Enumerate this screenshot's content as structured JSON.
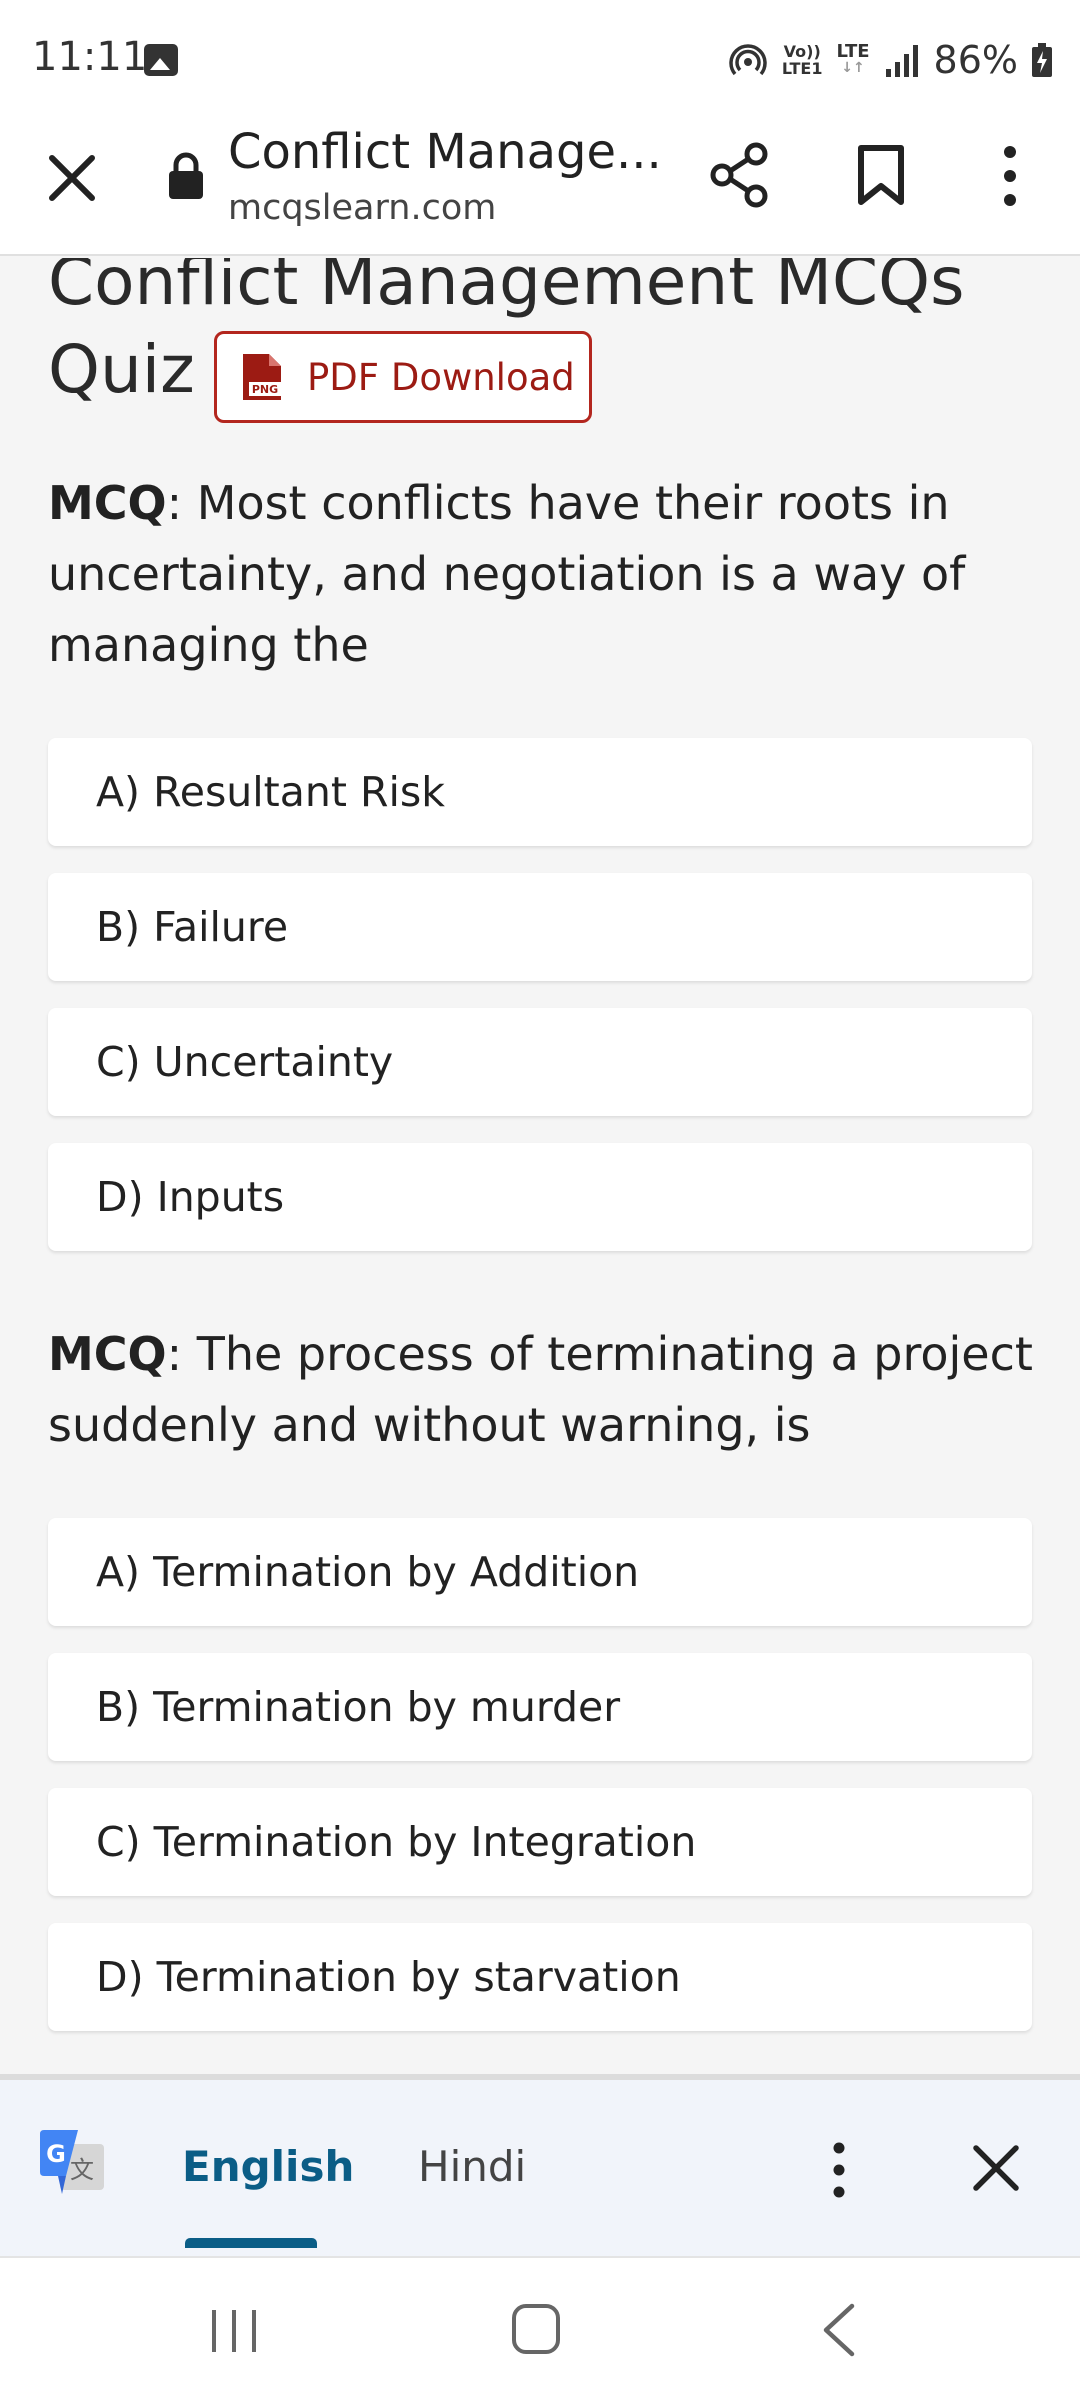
{
  "status_bar": {
    "time": "11:11",
    "volte_top": "Vo))",
    "volte_bottom": "LTE1",
    "network": "LTE",
    "battery": "86%"
  },
  "toolbar": {
    "page_title": "Conflict Manage...",
    "url": "mcqslearn.com"
  },
  "page": {
    "title": "Conflict Management MCQs Quiz",
    "pdf_button": "PDF Download",
    "pdf_icon_text": "PNG"
  },
  "questions": [
    {
      "prefix": "MCQ",
      "text": ": Most conflicts have their roots in uncertainty, and negotiation is a way of managing the",
      "options": [
        "A) Resultant Risk",
        "B) Failure",
        "C) Uncertainty",
        "D) Inputs"
      ]
    },
    {
      "prefix": "MCQ",
      "text": ": The process of terminating a project suddenly and without warning, is",
      "options": [
        "A) Termination by Addition",
        "B) Termination by murder",
        "C) Termination by Integration",
        "D) Termination by starvation"
      ]
    }
  ],
  "translate_bar": {
    "languages": [
      "English",
      "Hindi"
    ],
    "selected": "English"
  },
  "colors": {
    "accent": "#0b5d86",
    "pdf_red": "#b3261e",
    "background": "#f5f5f5"
  }
}
